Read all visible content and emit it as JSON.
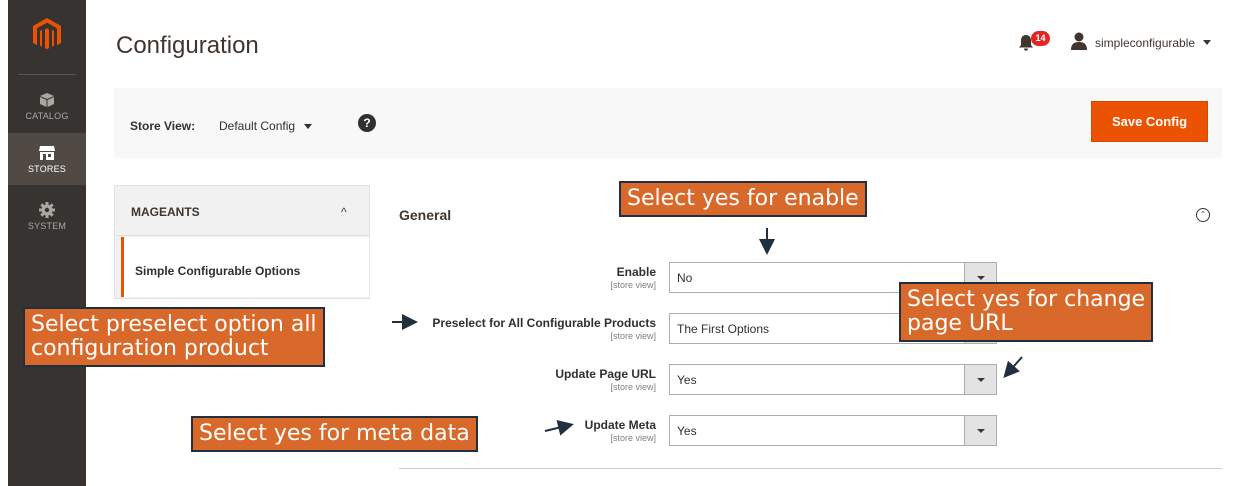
{
  "sidebar": {
    "logo_icon": "magento-logo-icon",
    "items": [
      {
        "label": "CATALOG",
        "icon": "catalog-box-icon",
        "active": false
      },
      {
        "label": "STORES",
        "icon": "store-icon",
        "active": true
      },
      {
        "label": "SYSTEM",
        "icon": "gear-icon",
        "active": false
      }
    ]
  },
  "header": {
    "title": "Configuration",
    "notifications_count": "14",
    "username": "simpleconfigurable"
  },
  "store_bar": {
    "label": "Store View:",
    "selected": "Default Config",
    "help": "?",
    "save_label": "Save Config"
  },
  "tabs": {
    "group_label": "MAGEANTS",
    "group_chevron": "^",
    "active_item": "Simple Configurable Options"
  },
  "section": {
    "title": "General",
    "fields": [
      {
        "label": "Enable",
        "scope": "[store view]",
        "value": "No"
      },
      {
        "label": "Preselect for All Configurable Products",
        "scope": "[store view]",
        "value": "The First Options"
      },
      {
        "label": "Update Page URL",
        "scope": "[store view]",
        "value": "Yes"
      },
      {
        "label": "Update Meta",
        "scope": "[store view]",
        "value": "Yes"
      }
    ]
  },
  "annotations": {
    "enable": "Select yes for enable",
    "preselect_line1": "Select preselect option all",
    "preselect_line2": "configuration product",
    "page_url_line1": "Select yes for change",
    "page_url_line2": "page URL",
    "meta": "Select yes for meta data"
  },
  "colors": {
    "sidebar_bg": "#373330",
    "accent": "#eb5202",
    "badge": "#e22626",
    "callout_bg": "#d9692a",
    "callout_border": "#20303f"
  }
}
